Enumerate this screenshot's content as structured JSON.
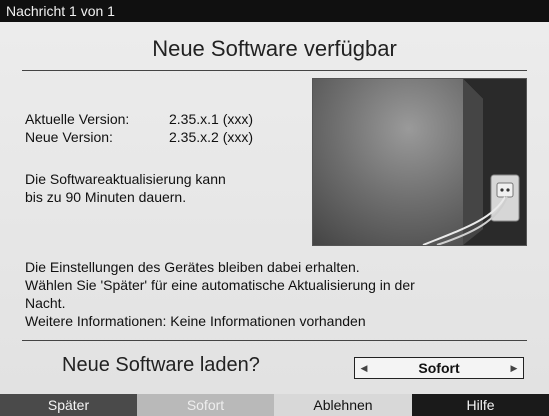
{
  "titlebar": {
    "title": "Nachricht 1 von 1"
  },
  "dialog": {
    "heading": "Neue Software verfügbar",
    "current_version_label": "Aktuelle Version:",
    "current_version_value": "2.35.x.1 (xxx)",
    "new_version_label": "Neue Version:",
    "new_version_value": "2.35.x.2 (xxx)",
    "duration_line1": "Die Softwareaktualisierung kann",
    "duration_line2": "bis zu 90 Minuten dauern.",
    "info_line1": "Die Einstellungen des Gerätes bleiben dabei erhalten.",
    "info_line2": "Wählen Sie 'Später' für eine automatische Aktualisierung in der",
    "info_line3": "Nacht.",
    "info_line4": "Weitere Informationen: Keine Informationen vorhanden",
    "prompt": "Neue Software laden?",
    "selector": {
      "value": "Sofort",
      "left_arrow": "◀",
      "right_arrow": "▶"
    }
  },
  "footer": {
    "buttons": [
      {
        "label": "Später",
        "color": "#4a4a4a"
      },
      {
        "label": "Sofort",
        "color": "#b9b9b9"
      },
      {
        "label": "Ablehnen",
        "color": "#d8d8d8"
      },
      {
        "label": "Hilfe",
        "color": "#1a1a1a"
      }
    ]
  }
}
